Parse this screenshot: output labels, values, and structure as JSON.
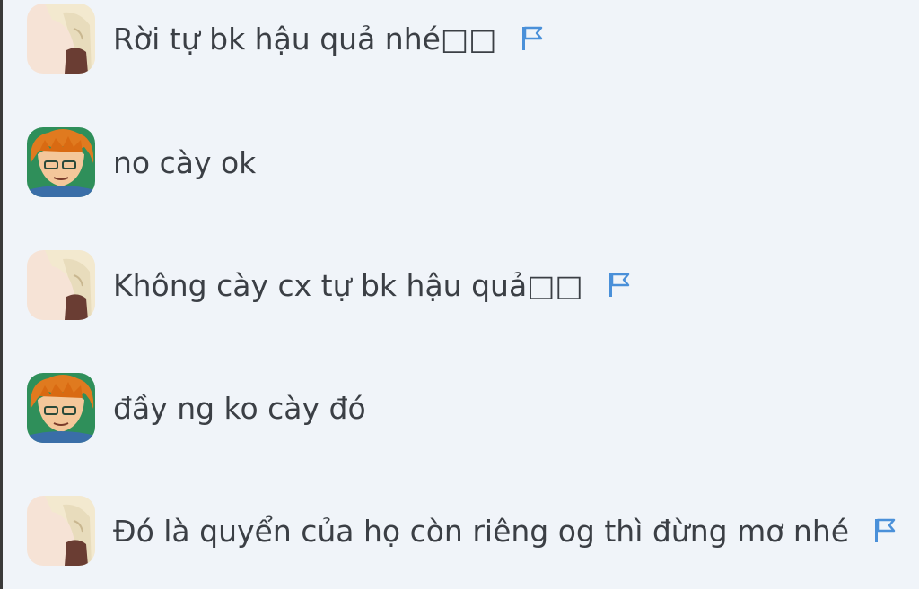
{
  "messages": [
    {
      "author": "user-a",
      "avatar": "blonde-girl-avatar",
      "text": "Rời tự bk hậu quả nhé□□",
      "flag": true
    },
    {
      "author": "user-b",
      "avatar": "orange-hair-boy-avatar",
      "text": "no cày ok",
      "flag": false
    },
    {
      "author": "user-a",
      "avatar": "blonde-girl-avatar",
      "text": "Không cày cx tự bk hậu quả□□",
      "flag": true
    },
    {
      "author": "user-b",
      "avatar": "orange-hair-boy-avatar",
      "text": "đầy ng ko cày đó",
      "flag": false
    },
    {
      "author": "user-a",
      "avatar": "blonde-girl-avatar",
      "text": "Đó là quyển của họ còn riêng og thì đừng mơ nhé",
      "flag": true
    }
  ],
  "colors": {
    "background": "#f0f4f9",
    "text": "#3b3f45",
    "flag": "#4a90d9"
  }
}
